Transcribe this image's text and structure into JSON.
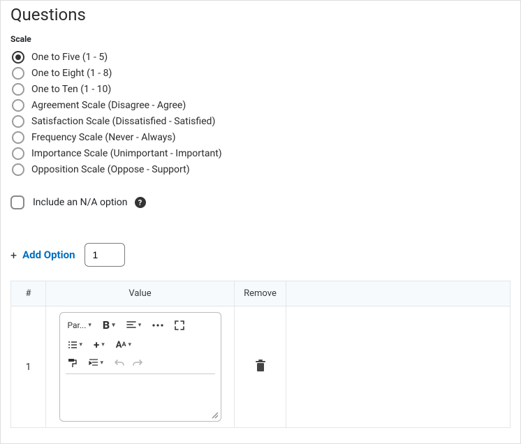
{
  "title": "Questions",
  "scale": {
    "label": "Scale",
    "selected": 0,
    "options": [
      "One to Five (1 - 5)",
      "One to Eight (1 - 8)",
      "One to Ten (1 - 10)",
      "Agreement Scale (Disagree - Agree)",
      "Satisfaction Scale (Dissatisfied - Satisfied)",
      "Frequency Scale (Never - Always)",
      "Importance Scale (Unimportant - Important)",
      "Opposition Scale (Oppose - Support)"
    ]
  },
  "include_na": {
    "label": "Include an N/A option",
    "checked": false
  },
  "add_option": {
    "label": "Add Option",
    "count": "1"
  },
  "table": {
    "headers": {
      "num": "#",
      "value": "Value",
      "remove": "Remove"
    },
    "rows": [
      {
        "num": "1",
        "value": ""
      }
    ]
  },
  "editor": {
    "paragraph": "Par..."
  }
}
